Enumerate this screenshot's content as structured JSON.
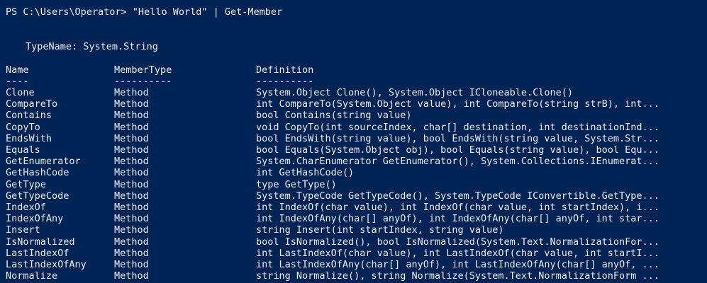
{
  "prompt": "PS C:\\Users\\Operator> \"Hello World\" | Get-Member",
  "typename_line": "TypeName: System.String",
  "headers": {
    "name": "Name",
    "member_type": "MemberType",
    "definition": "Definition"
  },
  "separators": {
    "name": "----",
    "member_type": "----------",
    "definition": "----------"
  },
  "rows": [
    {
      "name": "Clone",
      "member_type": "Method",
      "definition": "System.Object Clone(), System.Object ICloneable.Clone()"
    },
    {
      "name": "CompareTo",
      "member_type": "Method",
      "definition": "int CompareTo(System.Object value), int CompareTo(string strB), int..."
    },
    {
      "name": "Contains",
      "member_type": "Method",
      "definition": "bool Contains(string value)"
    },
    {
      "name": "CopyTo",
      "member_type": "Method",
      "definition": "void CopyTo(int sourceIndex, char[] destination, int destinationInd..."
    },
    {
      "name": "EndsWith",
      "member_type": "Method",
      "definition": "bool EndsWith(string value), bool EndsWith(string value, System.Str..."
    },
    {
      "name": "Equals",
      "member_type": "Method",
      "definition": "bool Equals(System.Object obj), bool Equals(string value), bool Equ..."
    },
    {
      "name": "GetEnumerator",
      "member_type": "Method",
      "definition": "System.CharEnumerator GetEnumerator(), System.Collections.IEnumerat..."
    },
    {
      "name": "GetHashCode",
      "member_type": "Method",
      "definition": "int GetHashCode()"
    },
    {
      "name": "GetType",
      "member_type": "Method",
      "definition": "type GetType()"
    },
    {
      "name": "GetTypeCode",
      "member_type": "Method",
      "definition": "System.TypeCode GetTypeCode(), System.TypeCode IConvertible.GetType..."
    },
    {
      "name": "IndexOf",
      "member_type": "Method",
      "definition": "int IndexOf(char value), int IndexOf(char value, int startIndex), i..."
    },
    {
      "name": "IndexOfAny",
      "member_type": "Method",
      "definition": "int IndexOfAny(char[] anyOf), int IndexOfAny(char[] anyOf, int star..."
    },
    {
      "name": "Insert",
      "member_type": "Method",
      "definition": "string Insert(int startIndex, string value)"
    },
    {
      "name": "IsNormalized",
      "member_type": "Method",
      "definition": "bool IsNormalized(), bool IsNormalized(System.Text.NormalizationFor..."
    },
    {
      "name": "LastIndexOf",
      "member_type": "Method",
      "definition": "int LastIndexOf(char value), int LastIndexOf(char value, int startI..."
    },
    {
      "name": "LastIndexOfAny",
      "member_type": "Method",
      "definition": "int LastIndexOfAny(char[] anyOf), int LastIndexOfAny(char[] anyOf, ..."
    },
    {
      "name": "Normalize",
      "member_type": "Method",
      "definition": "string Normalize(), string Normalize(System.Text.NormalizationForm ..."
    }
  ]
}
